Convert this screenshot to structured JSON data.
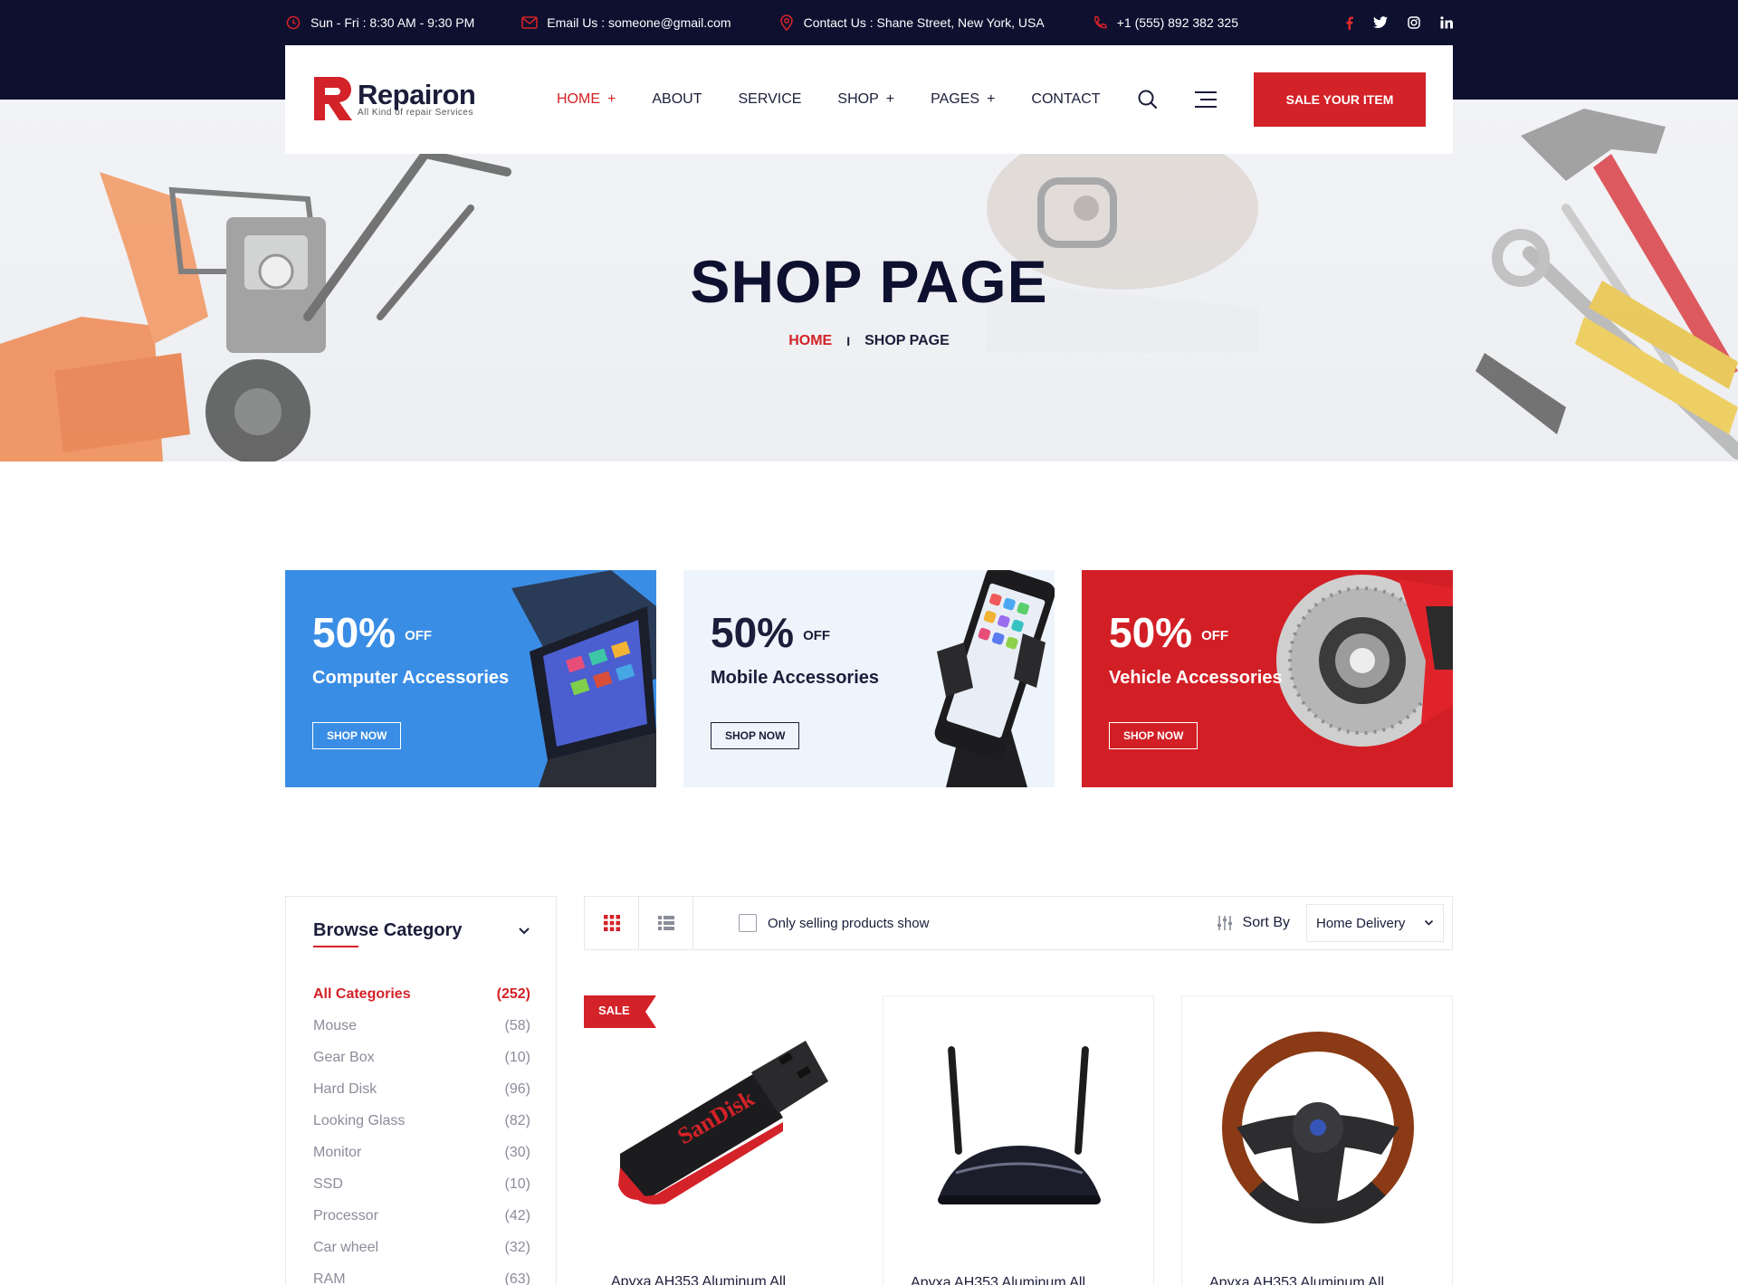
{
  "topbar": {
    "hours": "Sun - Fri : 8:30 AM - 9:30 PM",
    "email": "Email Us : someone@gmail.com",
    "address": "Contact Us : Shane Street, New York, USA",
    "phone": "+1 (555) 892 382 325",
    "socials": [
      "facebook-icon",
      "twitter-icon",
      "instagram-icon",
      "linkedin-icon"
    ]
  },
  "brand": {
    "name": "Repairon",
    "tagline": "All Kind of repair Services",
    "accent": "#d32228",
    "dark": "#0e1030"
  },
  "nav": {
    "items": [
      {
        "label": "HOME",
        "plus": "+"
      },
      {
        "label": "ABOUT",
        "plus": ""
      },
      {
        "label": "SERVICE",
        "plus": ""
      },
      {
        "label": "SHOP",
        "plus": "+"
      },
      {
        "label": "PAGES",
        "plus": "+"
      },
      {
        "label": "CONTACT",
        "plus": ""
      }
    ],
    "cta": "SALE YOUR ITEM"
  },
  "hero": {
    "title": "SHOP PAGE",
    "breadcrumb_home": "HOME",
    "breadcrumb_sep": "I",
    "breadcrumb_current": "SHOP PAGE"
  },
  "promos": [
    {
      "pct": "50%",
      "off": "OFF",
      "title": "Computer Accessories",
      "button": "SHOP NOW",
      "color": "#3a8de5"
    },
    {
      "pct": "50%",
      "off": "OFF",
      "title": "Mobile Accessories",
      "button": "SHOP NOW",
      "color": "#eef4fb"
    },
    {
      "pct": "50%",
      "off": "OFF",
      "title": "Vehicle Accessories",
      "button": "SHOP NOW",
      "color": "#d21f26"
    }
  ],
  "sidebar": {
    "title": "Browse Category",
    "categories": [
      {
        "name": "All Categories",
        "count": "(252)"
      },
      {
        "name": "Mouse",
        "count": "(58)"
      },
      {
        "name": "Gear Box",
        "count": "(10)"
      },
      {
        "name": "Hard Disk",
        "count": "(96)"
      },
      {
        "name": "Looking Glass",
        "count": "(82)"
      },
      {
        "name": "Monitor",
        "count": "(30)"
      },
      {
        "name": "SSD",
        "count": "(10)"
      },
      {
        "name": "Processor",
        "count": "(42)"
      },
      {
        "name": "Car wheel",
        "count": "(32)"
      },
      {
        "name": "RAM",
        "count": "(63)"
      }
    ]
  },
  "toolbar": {
    "only_selling": "Only selling products show",
    "sort_label": "Sort By",
    "sort_value": "Home Delivery"
  },
  "products": [
    {
      "badge": "SALE",
      "name": "Apyxa AH353 Aluminum All"
    },
    {
      "name": "Apyxa AH353 Aluminum All"
    },
    {
      "name": "Apyxa AH353 Aluminum All"
    }
  ]
}
